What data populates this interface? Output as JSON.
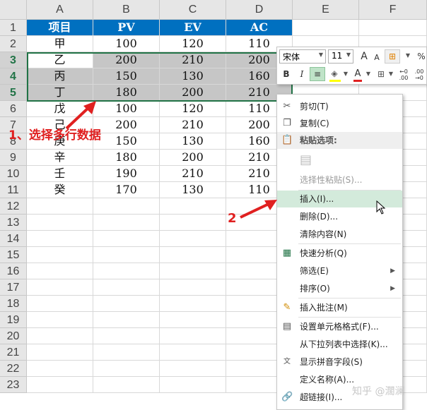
{
  "columns": [
    "A",
    "B",
    "C",
    "D",
    "E",
    "F"
  ],
  "rows": [
    "1",
    "2",
    "3",
    "4",
    "5",
    "6",
    "7",
    "8",
    "9",
    "10",
    "11",
    "12",
    "13",
    "14",
    "15",
    "16",
    "17",
    "18",
    "19",
    "20",
    "21",
    "22",
    "23"
  ],
  "table": {
    "header": [
      "项目",
      "PV",
      "EV",
      "AC"
    ],
    "rows": [
      [
        "甲",
        "100",
        "120",
        "110"
      ],
      [
        "乙",
        "200",
        "210",
        "200"
      ],
      [
        "丙",
        "150",
        "130",
        "160"
      ],
      [
        "丁",
        "180",
        "200",
        "210"
      ],
      [
        "戊",
        "100",
        "120",
        "110"
      ],
      [
        "己",
        "200",
        "210",
        "200"
      ],
      [
        "庚",
        "150",
        "130",
        "160"
      ],
      [
        "辛",
        "180",
        "200",
        "210"
      ],
      [
        "壬",
        "190",
        "210",
        "210"
      ],
      [
        "癸",
        "170",
        "130",
        "110"
      ]
    ]
  },
  "mini_toolbar": {
    "font": "宋体",
    "size": "11",
    "grow": "A",
    "shrink": "A",
    "bold": "B",
    "italic": "I",
    "font_color": "A",
    "percent": "%",
    "dec_inc": "←0 .00",
    "dec_dec": ".00 →0"
  },
  "menu": {
    "cut": "剪切(T)",
    "copy": "复制(C)",
    "paste_options": "粘贴选项:",
    "paste_special": "选择性粘贴(S)...",
    "insert": "插入(I)...",
    "delete": "删除(D)...",
    "clear": "清除内容(N)",
    "quick_analysis": "快速分析(Q)",
    "filter": "筛选(E)",
    "sort": "排序(O)",
    "insert_comment": "插入批注(M)",
    "format_cells": "设置单元格格式(F)...",
    "pick_list": "从下拉列表中选择(K)...",
    "phonetic": "显示拼音字段(S)",
    "define_name": "定义名称(A)...",
    "hyperlink": "超链接(I)..."
  },
  "annotations": {
    "step1": "1、选择多行数据",
    "step2": "2"
  },
  "watermark": "知乎 @濶澜",
  "colors": {
    "header_fill": "#0070c0",
    "selection_fill": "#c6c6c6",
    "selection_border": "#217346",
    "highlight": "#d3eadb",
    "annotation": "#e02020"
  }
}
